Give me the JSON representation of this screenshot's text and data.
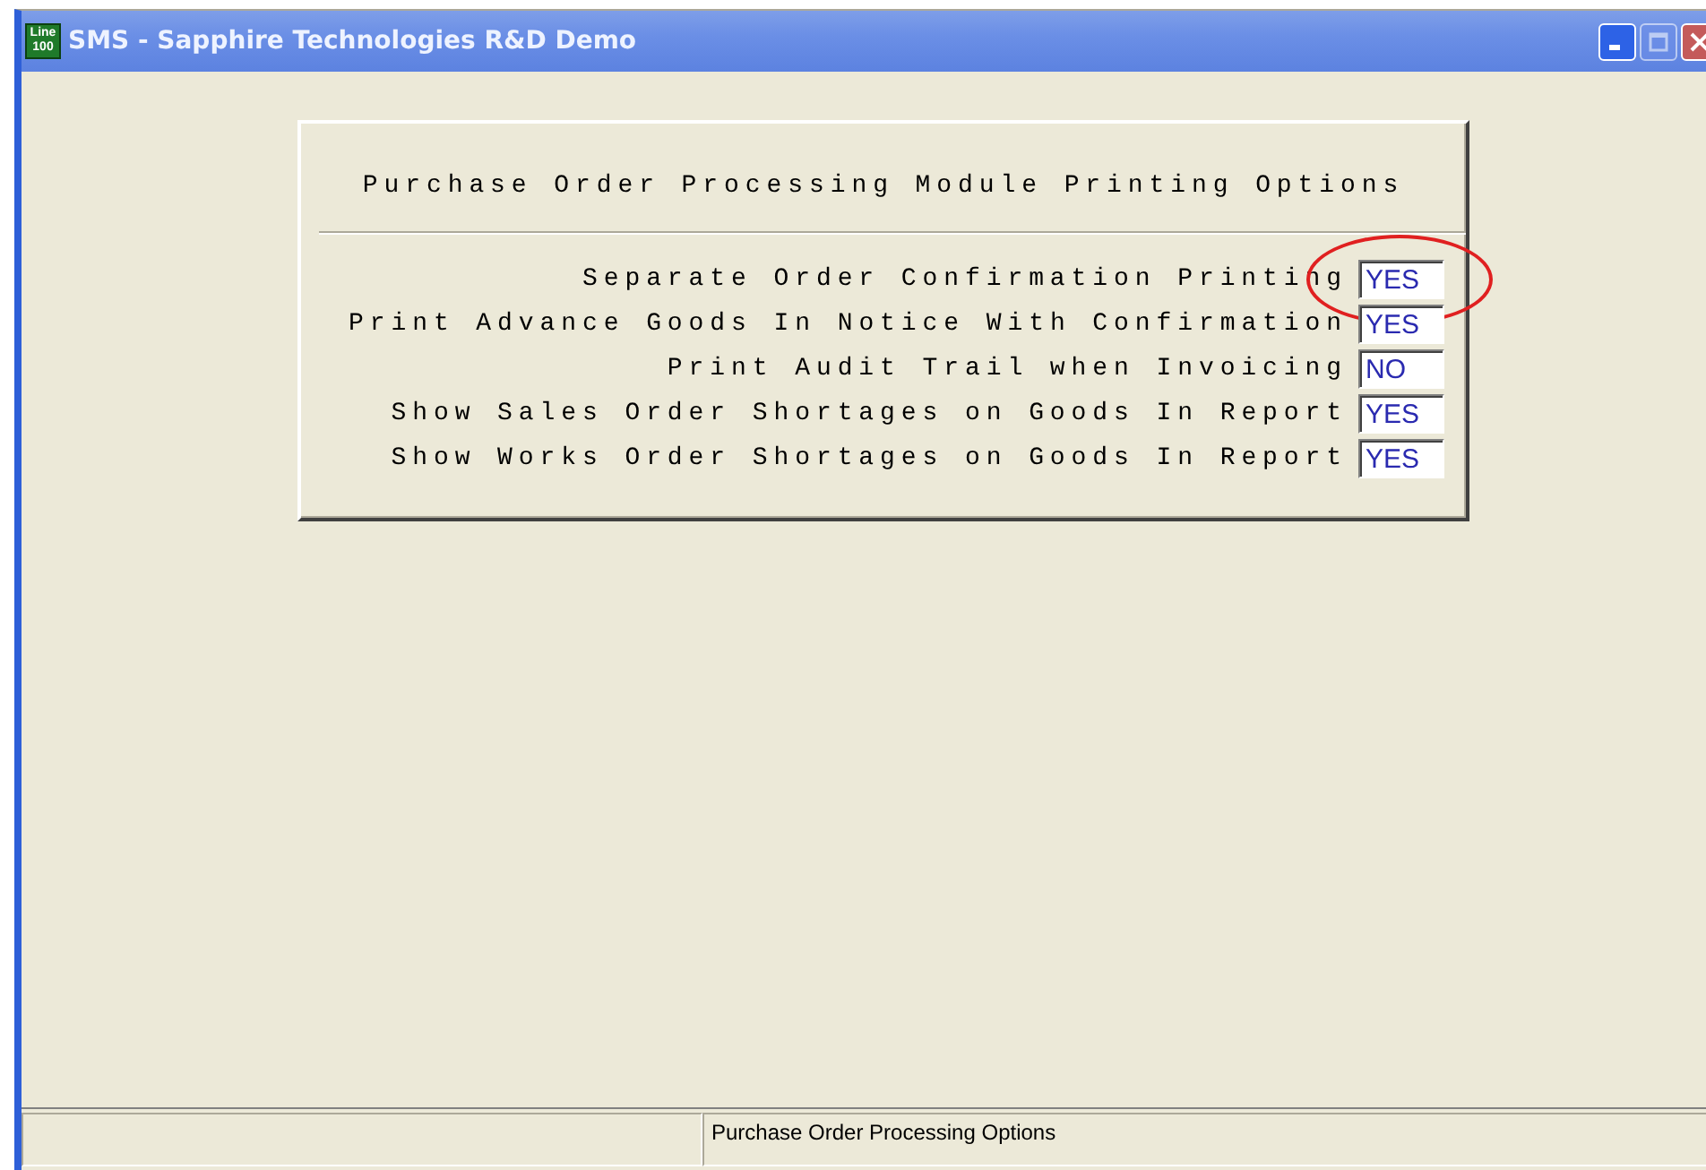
{
  "window": {
    "title": "SMS - Sapphire Technologies R&D Demo",
    "icon_text": [
      "Line",
      "100"
    ],
    "buttons": [
      {
        "kind": "minimize",
        "disabled": false
      },
      {
        "kind": "maximize",
        "disabled": true
      },
      {
        "kind": "close",
        "disabled": false
      }
    ]
  },
  "panel": {
    "title": "Purchase Order Processing Module Printing Options",
    "options": [
      {
        "label": "Separate Order Confirmation Printing",
        "value": "YES",
        "highlighted": true
      },
      {
        "label": "Print Advance Goods In Notice With Confirmation",
        "value": "YES",
        "highlighted": false
      },
      {
        "label": "Print Audit Trail when Invoicing",
        "value": "NO",
        "highlighted": false
      },
      {
        "label": "Show Sales Order Shortages on Goods In Report",
        "value": "YES",
        "highlighted": false
      },
      {
        "label": "Show Works Order Shortages on Goods In Report",
        "value": "YES",
        "highlighted": false
      }
    ]
  },
  "status_bar": {
    "message": "Purchase Order Processing Options"
  }
}
